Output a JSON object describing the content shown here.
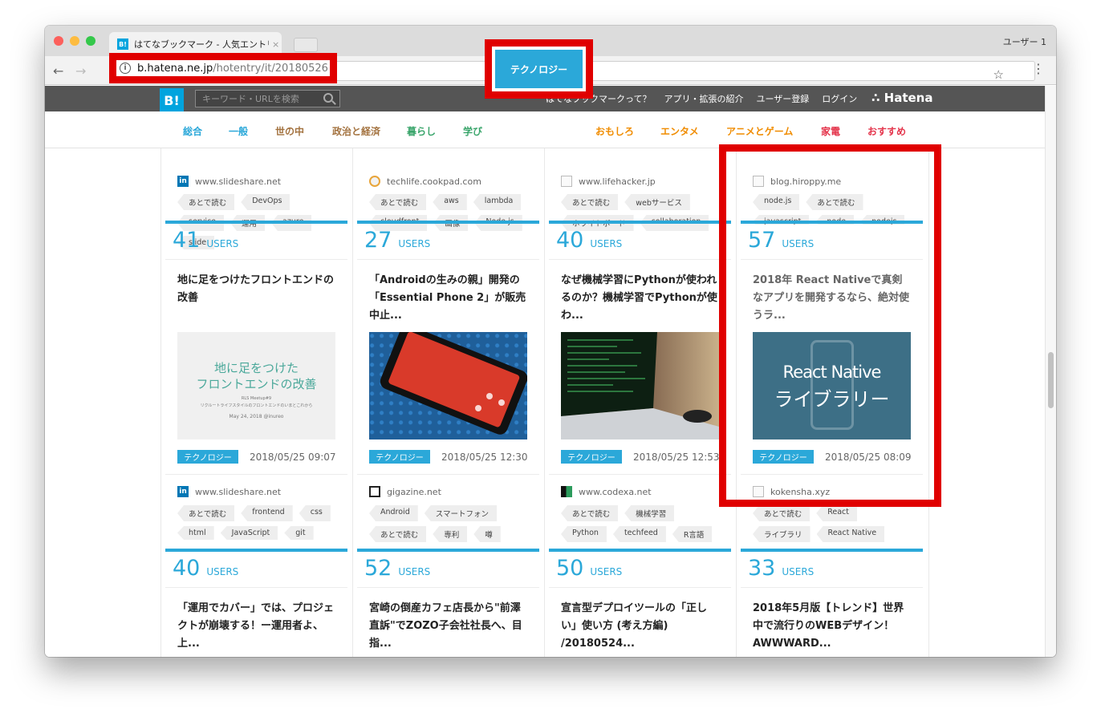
{
  "browser": {
    "tab_title": "はてなブックマーク - 人気エントリー",
    "tab_close": "×",
    "profile": "ユーザー 1",
    "url_host": "b.hatena.ne.jp",
    "url_path": "/hotentry/it/20180526",
    "back": "←",
    "forward": "→",
    "star": "☆",
    "menu": "⋮",
    "info": "i"
  },
  "header": {
    "logo": "B!",
    "search_placeholder": "キーワード・URLを検索",
    "links": [
      "はてなブックマークって？",
      "アプリ・拡張の紹介",
      "ユーザー登録",
      "ログイン"
    ],
    "hatena": "∴ Hatena"
  },
  "categories": [
    {
      "label": "総合",
      "color": "#2ba8d9"
    },
    {
      "label": "一般",
      "color": "#2ba8d9"
    },
    {
      "label": "世の中",
      "color": "#a3723f"
    },
    {
      "label": "政治と経済",
      "color": "#a3723f"
    },
    {
      "label": "暮らし",
      "color": "#3aa56b"
    },
    {
      "label": "学び",
      "color": "#3aa56b"
    },
    {
      "label": "テクノロジー",
      "color": "#2ba8d9"
    },
    {
      "label": "おもしろ",
      "color": "#f08c00"
    },
    {
      "label": "エンタメ",
      "color": "#f08c00"
    },
    {
      "label": "アニメとゲーム",
      "color": "#f08c00"
    },
    {
      "label": "家電",
      "color": "#e4344b"
    },
    {
      "label": "おすすめ",
      "color": "#e4344b"
    }
  ],
  "top_meta": [
    {
      "site": "www.slideshare.net",
      "tags": [
        "あとで読む",
        "DevOps",
        "service",
        "運用",
        "azure",
        "slide"
      ]
    },
    {
      "site": "techlife.cookpad.com",
      "tags": [
        "あとで読む",
        "aws",
        "lambda",
        "cloudfront",
        "画像",
        "Node.js"
      ]
    },
    {
      "site": "www.lifehacker.jp",
      "tags": [
        "あとで読む",
        "webサービス",
        "ホワイトボード",
        "collaboration"
      ]
    },
    {
      "site": "blog.hiroppy.me",
      "tags": [
        "node.js",
        "あとで読む",
        "javascript",
        "node",
        "nodejs"
      ]
    }
  ],
  "entries": [
    {
      "users": "41",
      "users_label": "USERS",
      "title": "地に足をつけたフロントエンドの改善",
      "category": "テクノロジー",
      "date": "2018/05/25 09:07",
      "site": "www.slideshare.net",
      "tags": [
        "あとで読む",
        "frontend",
        "css",
        "html",
        "JavaScript",
        "git"
      ],
      "thumb": {
        "line1": "地に足をつけた",
        "line2": "フロントエンドの改善",
        "sub1": "RLS Meetup#9",
        "sub2": "リクルートライフスタイルのフロントエンドのいまとこれから",
        "sub3": "May 24, 2018 @inureo"
      }
    },
    {
      "users": "27",
      "users_label": "USERS",
      "title": "「Androidの生みの親」開発の「Essential Phone 2」が販売中止...",
      "category": "テクノロジー",
      "date": "2018/05/25 12:30",
      "site": "gigazine.net",
      "tags": [
        "Android",
        "スマートフォン",
        "あとで読む",
        "専利",
        "噂"
      ]
    },
    {
      "users": "40",
      "users_label": "USERS",
      "title": "なぜ機械学習にPythonが使われるのか？機械学習でPythonが使わ...",
      "category": "テクノロジー",
      "date": "2018/05/25 12:53",
      "site": "www.codexa.net",
      "tags": [
        "あとで読む",
        "機械学習",
        "Python",
        "techfeed",
        "R言語"
      ]
    },
    {
      "users": "57",
      "users_label": "USERS",
      "title": "2018年 React Nativeで真剣なアプリを開発するなら、絶対使うラ...",
      "category": "テクノロジー",
      "date": "2018/05/25 08:09",
      "site": "kokensha.xyz",
      "tags": [
        "あとで読む",
        "React",
        "ライブラリ",
        "React Native"
      ],
      "thumb": {
        "line1": "React Native",
        "line2": "ライブラリー"
      }
    }
  ],
  "bottom_entries": [
    {
      "users": "40",
      "users_label": "USERS",
      "title": "「運用でカバー」では、プロジェクトが崩壊する！ー運用者よ、上..."
    },
    {
      "users": "52",
      "users_label": "USERS",
      "title": "宮崎の倒産カフェ店長から\"前澤直訴\"でZOZO子会社社長へ、目指..."
    },
    {
      "users": "50",
      "users_label": "USERS",
      "title": "宣言型デプロイツールの「正しい」使い方 (考え方編) /20180524..."
    },
    {
      "users": "33",
      "users_label": "USERS",
      "title": "2018年5月版【トレンド】世界中で流行りのWEBデザイン！AWWWARD..."
    }
  ]
}
